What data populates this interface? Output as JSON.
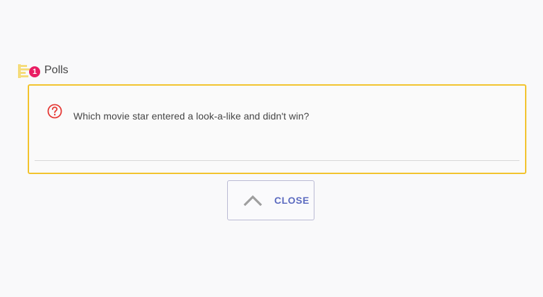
{
  "polls": {
    "title": "Polls",
    "badge_count": "1",
    "icon": "bar-list-icon",
    "accent_color": "#f2c32b",
    "badge_color": "#e91e63"
  },
  "poll_card": {
    "question_icon": "question-circle-icon",
    "question_icon_color": "#e53935",
    "question": "Which movie star entered a look-a-like and didn't win?"
  },
  "close_button": {
    "label": "CLOSE",
    "icon": "chevron-up-icon",
    "label_color": "#5c6bc0"
  }
}
